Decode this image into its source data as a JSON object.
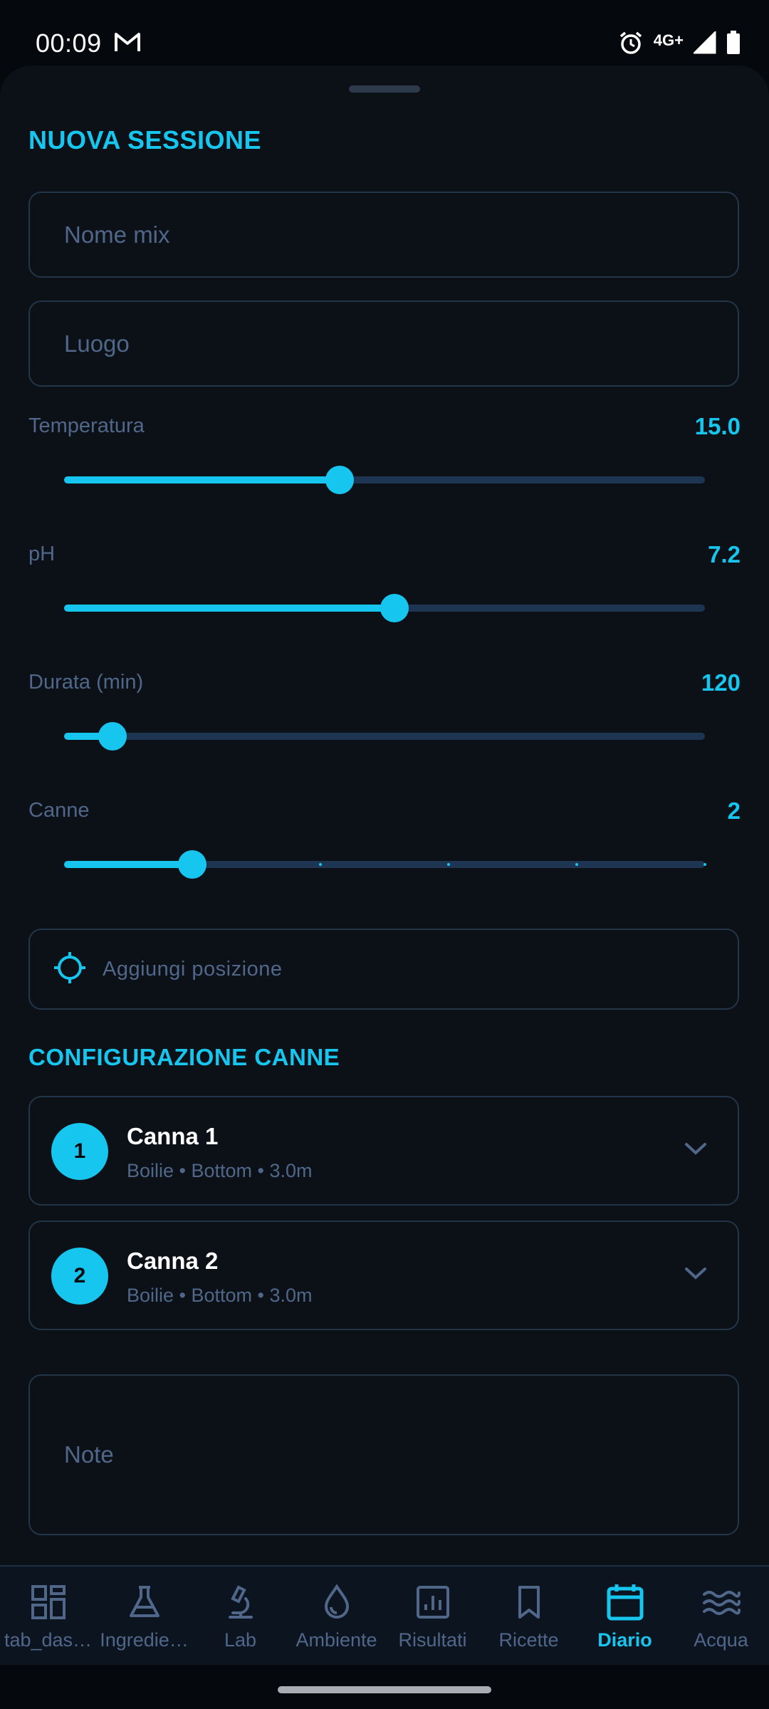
{
  "status_bar": {
    "time": "00:09",
    "network": "4G+",
    "icons": [
      "gmail-icon",
      "alarm-icon",
      "signal-icon",
      "battery-icon"
    ]
  },
  "colors": {
    "accent": "#16c6ee",
    "background": "#0c1118",
    "muted_text": "#50678a",
    "border": "#233548"
  },
  "form": {
    "title": "NUOVA SESSIONE",
    "mix_name": {
      "value": "",
      "placeholder": "Nome mix"
    },
    "location": {
      "value": "",
      "placeholder": "Luogo"
    },
    "sliders": [
      {
        "label": "Temperatura",
        "value": "15.0",
        "fraction": 0.43
      },
      {
        "label": "pH",
        "value": "7.2",
        "fraction": 0.515
      },
      {
        "label": "Durata (min)",
        "value": "120",
        "fraction": 0.075
      },
      {
        "label": "Canne",
        "value": "2",
        "fraction": 0.2,
        "steps": 6
      }
    ],
    "add_position": {
      "label": "Aggiungi posizione",
      "icon": "crosshair-icon"
    },
    "notes": {
      "value": "",
      "placeholder": "Note"
    }
  },
  "rods": {
    "title": "CONFIGURAZIONE CANNE",
    "items": [
      {
        "number": "1",
        "name": "Canna 1",
        "details": "Boilie • Bottom • 3.0m",
        "icon": "chevron-down-icon"
      },
      {
        "number": "2",
        "name": "Canna 2",
        "details": "Boilie • Bottom • 3.0m",
        "icon": "chevron-down-icon"
      }
    ]
  },
  "bottom_nav": {
    "active": "Diario",
    "items": [
      {
        "label": "tab_das…",
        "icon": "dashboard-icon"
      },
      {
        "label": "Ingredie…",
        "icon": "flask-icon"
      },
      {
        "label": "Lab",
        "icon": "microscope-icon"
      },
      {
        "label": "Ambiente",
        "icon": "water-drop-icon"
      },
      {
        "label": "Risultati",
        "icon": "chart-icon"
      },
      {
        "label": "Ricette",
        "icon": "bookmark-icon"
      },
      {
        "label": "Diario",
        "icon": "calendar-icon"
      },
      {
        "label": "Acqua",
        "icon": "waves-icon"
      }
    ]
  }
}
